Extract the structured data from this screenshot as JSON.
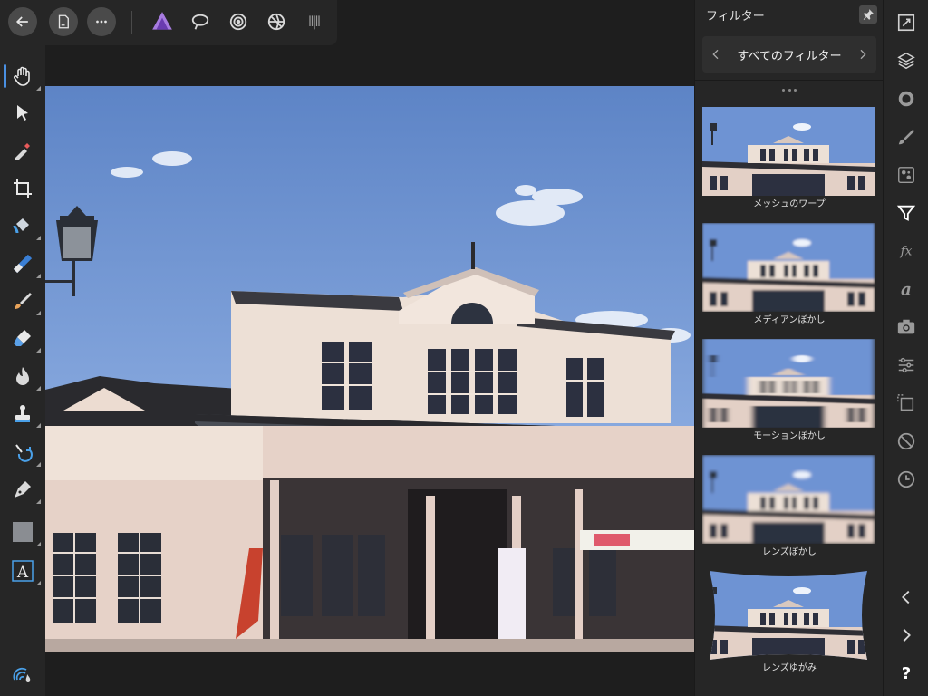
{
  "top_bar": {
    "back_icon": "back-arrow-icon",
    "document_icon": "document-icon",
    "more_icon": "ellipsis-icon",
    "personas": [
      "photo-persona-icon",
      "liquify-persona-icon",
      "develop-persona-icon",
      "tone-mapping-persona-icon",
      "export-persona-icon"
    ]
  },
  "left_tools": [
    "hand-tool-icon",
    "move-tool-icon",
    "color-picker-icon",
    "crop-tool-icon",
    "flood-fill-icon",
    "gradient-tool-icon",
    "paint-brush-icon",
    "erase-brush-icon",
    "dodge-burn-icon",
    "clone-stamp-icon",
    "red-eye-icon",
    "pen-tool-icon",
    "shape-tool-icon",
    "text-tool-icon",
    "color-swatch-icon"
  ],
  "filter_panel": {
    "title": "フィルター",
    "category": "すべてのフィルター",
    "filters": [
      {
        "label": "メッシュのワープ",
        "effect": "none"
      },
      {
        "label": "メディアンぼかし",
        "effect": "median"
      },
      {
        "label": "モーションぼかし",
        "effect": "motion"
      },
      {
        "label": "レンズぼかし",
        "effect": "lens"
      },
      {
        "label": "レンズゆがみ",
        "effect": "distort"
      }
    ]
  },
  "right_tools": [
    "canvas-size-icon",
    "layers-icon",
    "color-wheel-icon",
    "brushes-icon",
    "channels-icon",
    "filters-icon",
    "fx-icon",
    "text-styles-icon",
    "camera-icon",
    "adjustments-icon",
    "transform-icon",
    "no-entry-icon",
    "history-icon",
    "chevron-left-icon",
    "chevron-right-icon",
    "help-icon"
  ],
  "help_label": "?",
  "colors": {
    "accent": "#4a90e2",
    "sky_top": "#5f86c8",
    "sky_bottom": "#9ab6e6",
    "building": "#e9d9cf"
  }
}
